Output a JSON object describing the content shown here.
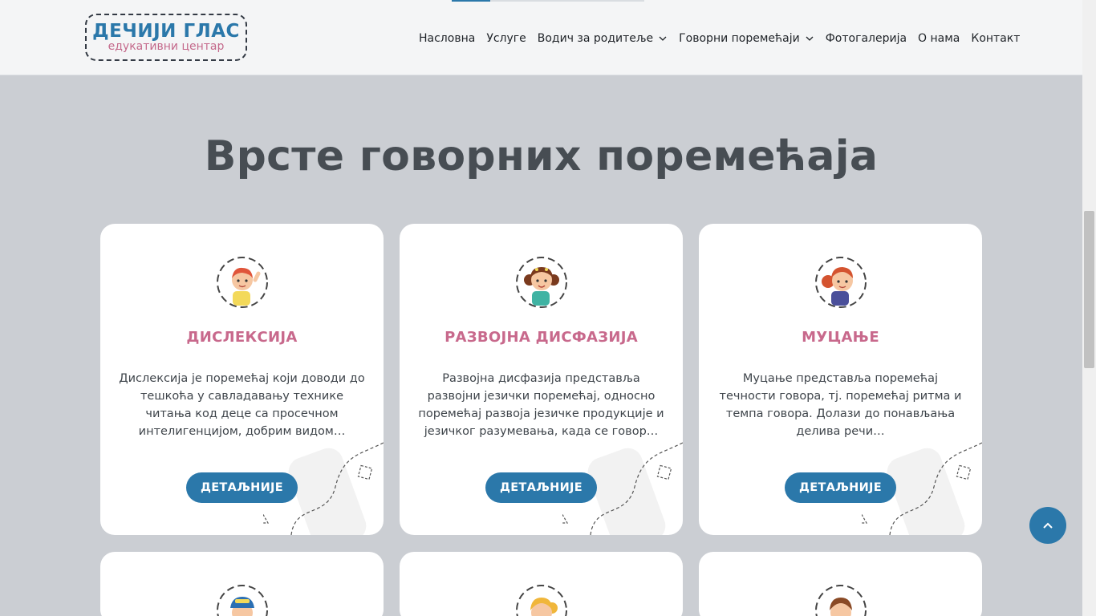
{
  "header": {
    "logo_line1": "ДЕЧИЈИ ГЛАС",
    "logo_line2": "едукативни центар",
    "nav": [
      {
        "label": "Насловна",
        "dropdown": false
      },
      {
        "label": "Услуге",
        "dropdown": false
      },
      {
        "label": "Водич за родитеље",
        "dropdown": true
      },
      {
        "label": "Говорни поремећаји",
        "dropdown": true
      },
      {
        "label": "Фотогалерија",
        "dropdown": false
      },
      {
        "label": "О нама",
        "dropdown": false
      },
      {
        "label": "Контакт",
        "dropdown": false
      }
    ]
  },
  "main": {
    "title": "Врсте говорних поремећаја",
    "cards": [
      {
        "title": "ДИСЛЕКСИЈА",
        "text": "Дислексија је поремећај који доводи до тешкоћа у савладавању технике читања код деце са просечном интелигенцијом, добрим видом…",
        "button": "ДЕТАЉНИЈЕ",
        "icon": "boy-waving-icon"
      },
      {
        "title": "РАЗВОЈНА ДИСФАЗИЈА",
        "text": "Развојна дисфазија представља развојни језички поремећај, односно поремећај развоја језичке продукције и језичког разумевања, када се говор…",
        "button": "ДЕТАЉНИЈЕ",
        "icon": "girl-curly-icon"
      },
      {
        "title": "МУЦАЊЕ",
        "text": "Муцање представља поремећај течности говора, тј. поремећај ритма и темпа говора. Долази до понављања делива речи…",
        "button": "ДЕТАЉНИЈЕ",
        "icon": "girl-ponytail-icon"
      }
    ]
  },
  "colors": {
    "brand_blue": "#2b78aa",
    "brand_pink": "#c8698c",
    "background": "#cbced3"
  }
}
